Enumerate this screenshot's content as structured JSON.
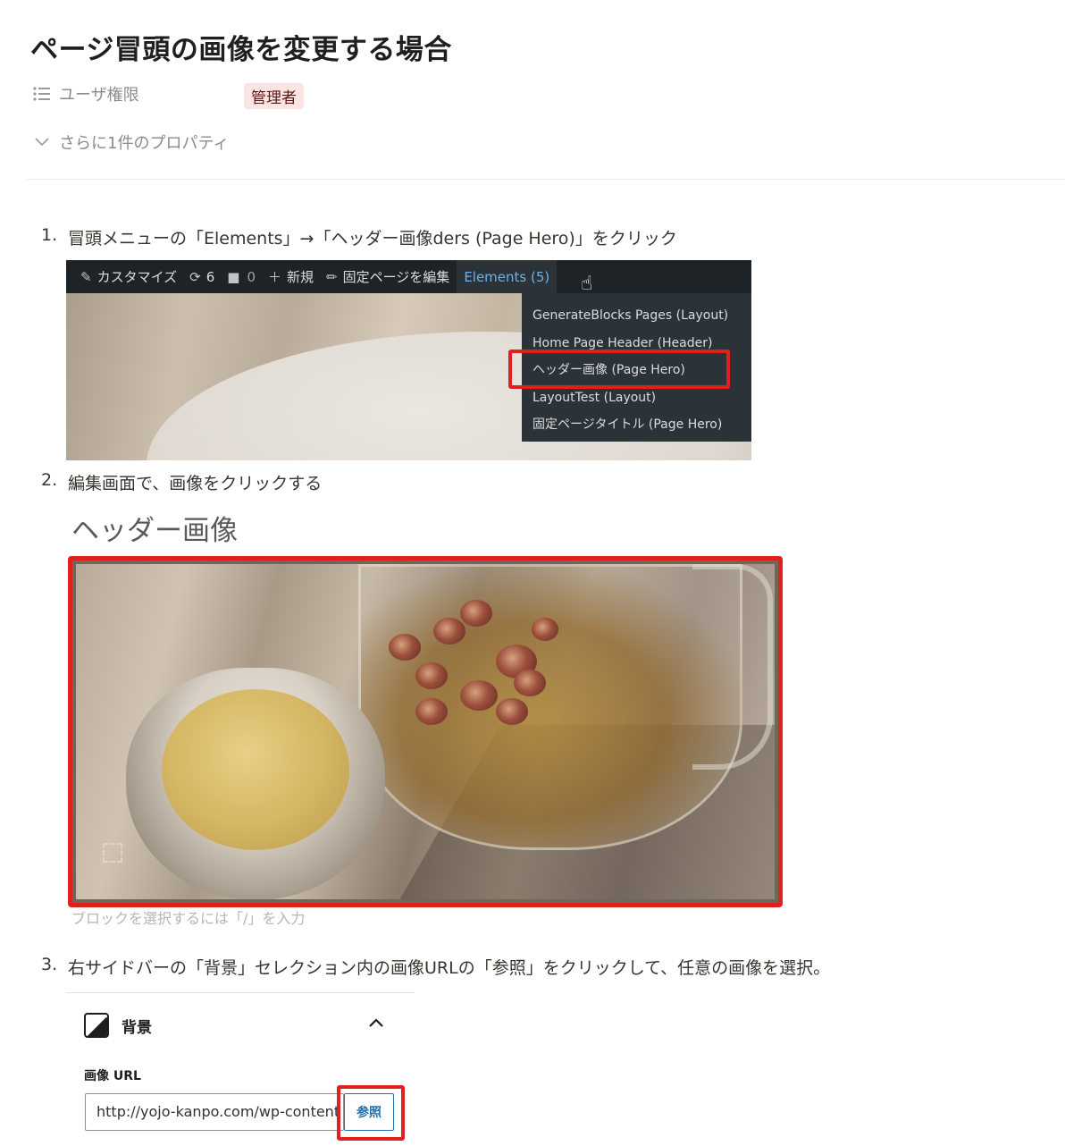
{
  "page": {
    "title": "ページ冒頭の画像を変更する場合"
  },
  "properties": {
    "user_role_label": "ユーザ権限",
    "user_role_value": "管理者",
    "more_props": "さらに1件のプロパティ"
  },
  "steps": [
    {
      "num": "1.",
      "text": "冒頭メニューの「Elements」→「ヘッダー画像ders (Page Hero)」をクリック"
    },
    {
      "num": "2.",
      "text": "編集画面で、画像をクリックする"
    },
    {
      "num": "3.",
      "text": "右サイドバーの「背景」セレクション内の画像URLの「参照」をクリックして、任意の画像を選択。"
    }
  ],
  "adminbar": {
    "customize": "カスタマイズ",
    "updates": "6",
    "comments": "0",
    "new": "新規",
    "edit_page": "固定ページを編集",
    "elements": "Elements (5)"
  },
  "elements_menu": [
    "GenerateBlocks Pages (Layout)",
    "Home Page Header (Header)",
    "ヘッダー画像 (Page Hero)",
    "LayoutTest (Layout)",
    "固定ページタイトル (Page Hero)"
  ],
  "editor": {
    "heading": "ヘッダー画像",
    "hint": "ブロックを選択するには「/」を入力"
  },
  "sidebar": {
    "section_title": "背景",
    "url_label": "画像 URL",
    "url_value": "http://yojo-kanpo.com/wp-content",
    "browse": "参照"
  },
  "colors": {
    "highlight_red": "#e0201d",
    "tag_bg": "#fbe4e4",
    "admin_bar": "#1d2327",
    "link_blue": "#72aee6"
  }
}
